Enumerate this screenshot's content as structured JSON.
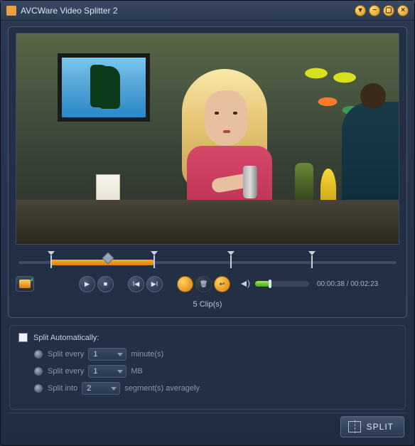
{
  "titlebar": {
    "title": "AVCWare Video Splitter 2"
  },
  "timeline": {
    "range_start_pct": 9,
    "range_end_pct": 36,
    "playhead_pct": 24,
    "markers_pct": [
      9,
      36,
      56,
      77
    ]
  },
  "controls": {
    "volume_pct": 28,
    "time_current": "00:00:38",
    "time_total": "00:02:23"
  },
  "clips": {
    "count_label": "5 Clip(s)"
  },
  "autosplit": {
    "checkbox_label": "Split Automatically:",
    "opt_minutes_prefix": "Split every",
    "opt_minutes_value": "1",
    "opt_minutes_suffix": "minute(s)",
    "opt_mb_prefix": "Split every",
    "opt_mb_value": "1",
    "opt_mb_suffix": "MB",
    "opt_seg_prefix": "Split into",
    "opt_seg_value": "2",
    "opt_seg_suffix": "segment(s) averagely"
  },
  "split_button": {
    "label": "SPLIT"
  }
}
